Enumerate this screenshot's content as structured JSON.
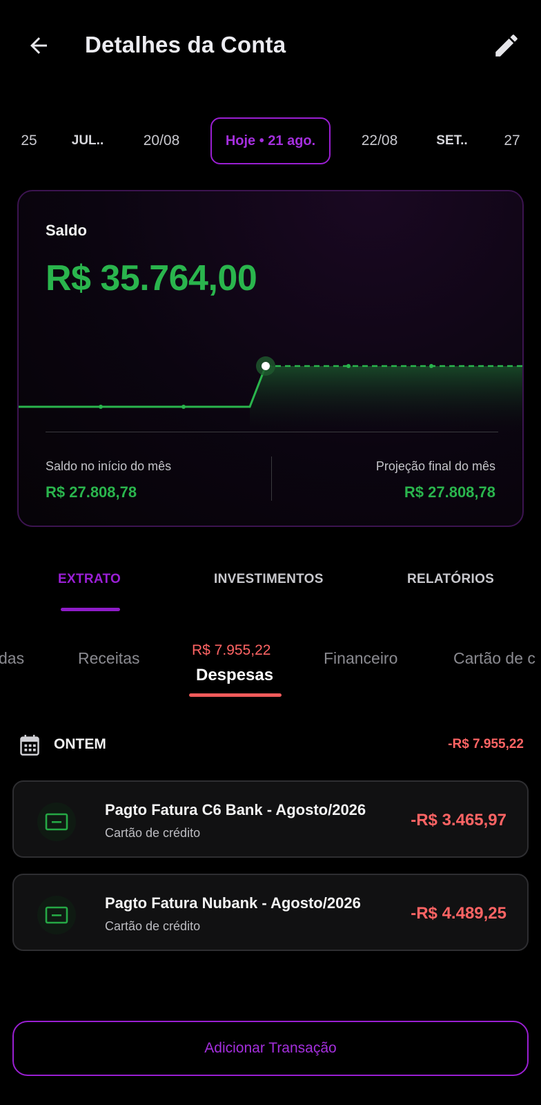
{
  "header": {
    "title": "Detalhes da Conta",
    "back_icon": "arrow-left-icon",
    "edit_icon": "pencil-icon"
  },
  "date_strip": {
    "items": [
      "25",
      "JUL..",
      "20/08",
      "Hoje • 21 ago.",
      "22/08",
      "SET..",
      "27"
    ],
    "selected_index": 3
  },
  "balance_card": {
    "label": "Saldo",
    "value": "R$ 35.764,00",
    "start_label": "Saldo no início do mês",
    "start_value": "R$ 27.808,78",
    "projection_label": "Projeção final do mês",
    "projection_value": "R$ 27.808,78"
  },
  "chart_data": {
    "type": "line",
    "title": "",
    "xlabel": "",
    "ylabel": "",
    "series": [
      {
        "style": "solid",
        "values": [
          27808.78,
          27808.78,
          27808.78,
          35764.0
        ]
      },
      {
        "style": "dashed",
        "values": [
          35764.0,
          35764.0,
          35764.0
        ]
      }
    ],
    "highlight_point": 35764.0
  },
  "main_tabs": {
    "items": [
      "EXTRATO",
      "INVESTIMENTOS",
      "RELATÓRIOS"
    ],
    "active_index": 0
  },
  "sub_tabs": {
    "left_partial": "das",
    "receitas": "Receitas",
    "active_amount": "R$ 7.955,22",
    "active_label": "Despesas",
    "financeiro": "Financeiro",
    "right_partial": "Cartão de c"
  },
  "group": {
    "label": "ONTEM",
    "total": "-R$ 7.955,22",
    "icon": "calendar-icon"
  },
  "transactions": [
    {
      "title": "Pagto Fatura C6 Bank - Agosto/2026",
      "category": "Cartão de crédito",
      "amount": "-R$ 3.465,97",
      "icon": "credit-card-icon"
    },
    {
      "title": "Pagto Fatura Nubank - Agosto/2026",
      "category": "Cartão de crédito",
      "amount": "-R$ 4.489,25",
      "icon": "credit-card-icon"
    }
  ],
  "add_button": {
    "label": "Adicionar Transação"
  },
  "colors": {
    "accent": "#9a1fd2",
    "positive": "#2ab54d",
    "negative": "#ff6464",
    "background": "#000000"
  }
}
